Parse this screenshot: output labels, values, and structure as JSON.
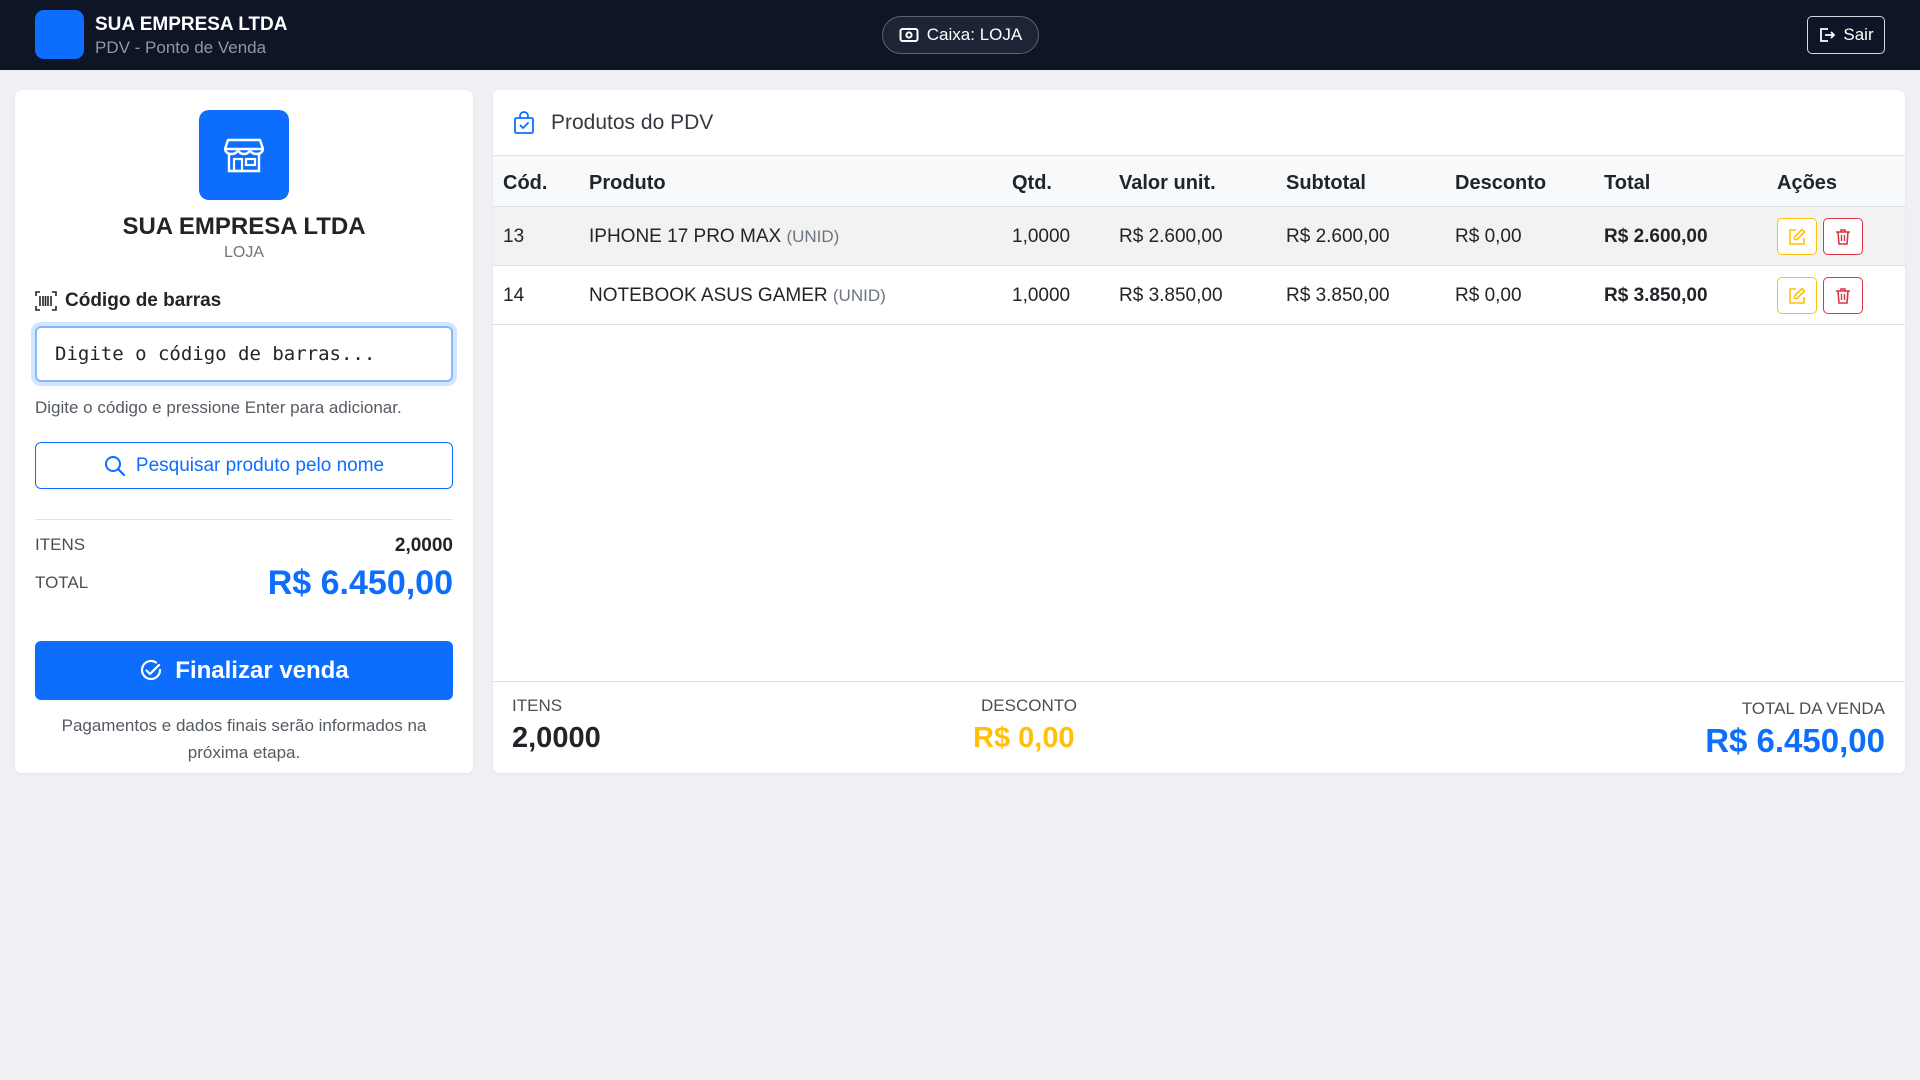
{
  "topbar": {
    "company": "SUA EMPRESA LTDA",
    "subtitle": "PDV - Ponto de Venda",
    "caixa": "Caixa: LOJA",
    "logout": "Sair"
  },
  "left": {
    "company": "SUA EMPRESA LTDA",
    "store": "LOJA",
    "barcode_label": "Código de barras",
    "barcode_placeholder": "Digite o código de barras...",
    "barcode_hint": "Digite o código e pressione Enter para adicionar.",
    "search_button": "Pesquisar produto pelo nome",
    "items_label": "ITENS",
    "items_value": "2,0000",
    "total_label": "TOTAL",
    "total_value": "R$ 6.450,00",
    "finalize_button": "Finalizar venda",
    "finalize_note": "Pagamentos e dados finais serão informados na próxima etapa."
  },
  "products": {
    "title": "Produtos do PDV",
    "columns": [
      "Cód.",
      "Produto",
      "Qtd.",
      "Valor unit.",
      "Subtotal",
      "Desconto",
      "Total",
      "Ações"
    ],
    "rows": [
      {
        "code": "13",
        "name": "IPHONE 17 PRO MAX",
        "unit": "(UNID)",
        "qty": "1,0000",
        "unit_price": "R$ 2.600,00",
        "subtotal": "R$ 2.600,00",
        "discount": "R$ 0,00",
        "total": "R$ 2.600,00"
      },
      {
        "code": "14",
        "name": "NOTEBOOK ASUS GAMER",
        "unit": "(UNID)",
        "qty": "1,0000",
        "unit_price": "R$ 3.850,00",
        "subtotal": "R$ 3.850,00",
        "discount": "R$ 0,00",
        "total": "R$ 3.850,00"
      }
    ]
  },
  "footer": {
    "items_label": "ITENS",
    "items_value": "2,0000",
    "discount_label": "DESCONTO",
    "discount_value": "R$ 0,00",
    "sale_total_label": "TOTAL DA VENDA",
    "sale_total_value": "R$ 6.450,00"
  },
  "colors": {
    "primary": "#0d6efd",
    "warning": "#ffc107",
    "danger": "#dc3545",
    "topbar": "#0d1526"
  },
  "icons": [
    "cash-icon",
    "logout-icon",
    "store-icon",
    "barcode-icon",
    "search-icon",
    "check-circle-icon",
    "bag-check-icon",
    "edit-icon",
    "trash-icon"
  ]
}
